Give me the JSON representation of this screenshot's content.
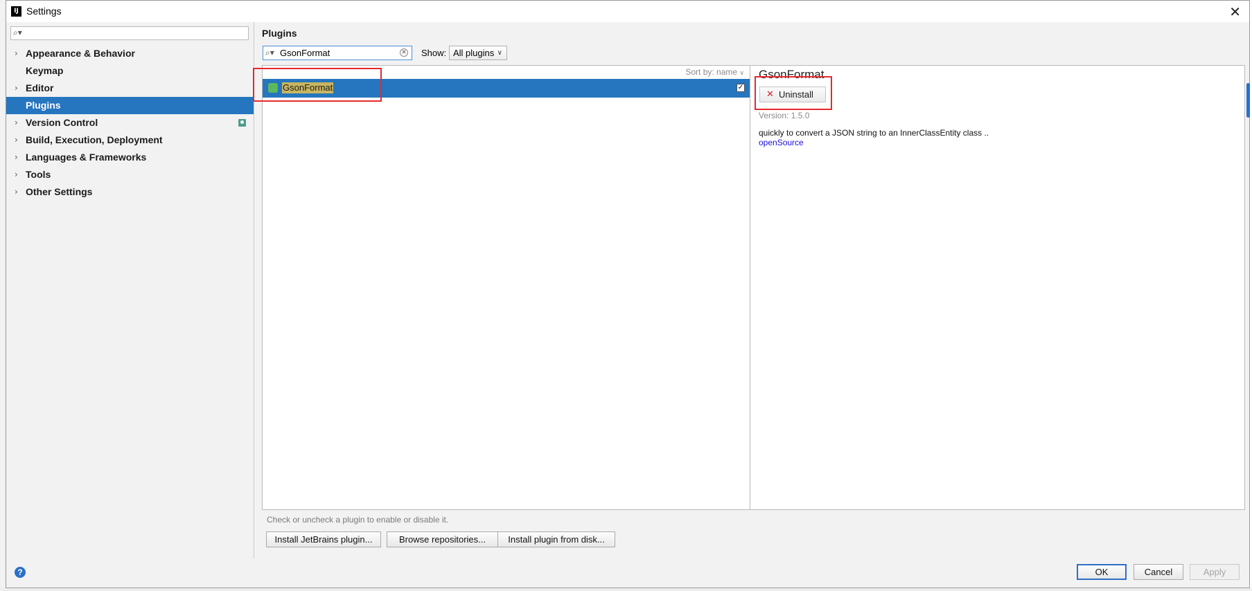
{
  "window": {
    "title": "Settings",
    "app_icon": "IJ"
  },
  "tree": {
    "search_placeholder": "",
    "items": [
      {
        "label": "Appearance & Behavior",
        "expandable": true
      },
      {
        "label": "Keymap",
        "expandable": false
      },
      {
        "label": "Editor",
        "expandable": true
      },
      {
        "label": "Plugins",
        "expandable": false,
        "selected": true
      },
      {
        "label": "Version Control",
        "expandable": true
      },
      {
        "label": "Build, Execution, Deployment",
        "expandable": true
      },
      {
        "label": "Languages & Frameworks",
        "expandable": true
      },
      {
        "label": "Tools",
        "expandable": true
      },
      {
        "label": "Other Settings",
        "expandable": true
      }
    ]
  },
  "plugins": {
    "title": "Plugins",
    "search_value": "GsonFormat",
    "show_label": "Show:",
    "show_value": "All plugins",
    "sort_label": "Sort by: name",
    "list": [
      {
        "name": "GsonFormat",
        "enabled": true
      }
    ],
    "detail": {
      "name": "GsonFormat",
      "uninstall_label": "Uninstall",
      "version": "Version: 1.5.0",
      "description": "quickly to convert a JSON string to an InnerClassEntity class ..",
      "link": "openSource"
    },
    "hint": "Check or uncheck a plugin to enable or disable it.",
    "buttons": {
      "install_jetbrains": "Install JetBrains plugin...",
      "browse": "Browse repositories...",
      "install_disk": "Install plugin from disk..."
    }
  },
  "footer": {
    "ok": "OK",
    "cancel": "Cancel",
    "apply": "Apply"
  },
  "colors": {
    "selection": "#2675bf",
    "highlight_box": "#e5282d",
    "link": "#1a0dd8"
  }
}
